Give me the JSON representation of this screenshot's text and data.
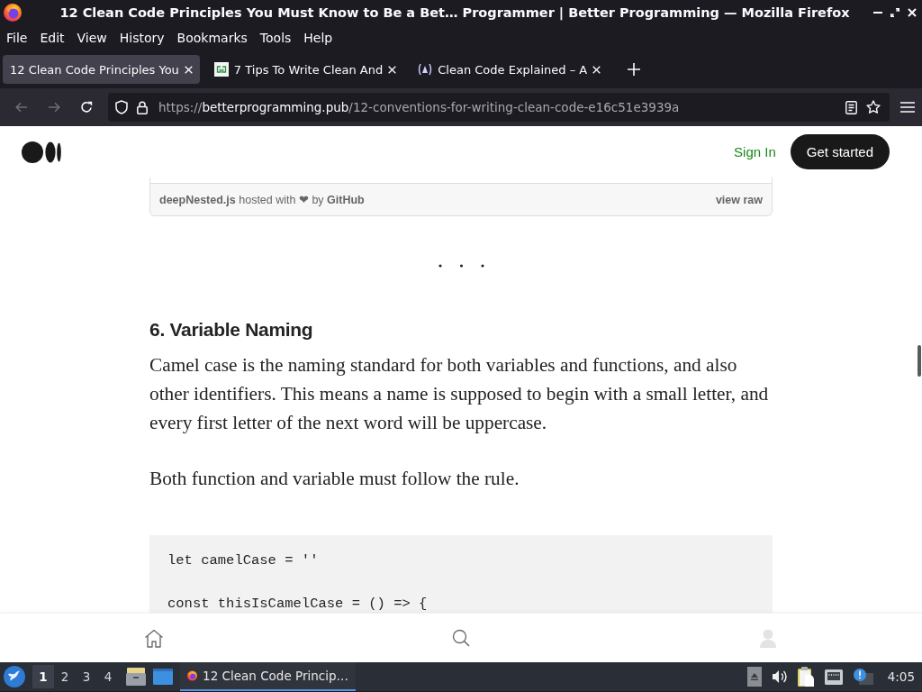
{
  "window": {
    "title": "12 Clean Code Principles You Must Know to Be a Bet… Programmer | Better Programming — Mozilla Firefox"
  },
  "menu": [
    "File",
    "Edit",
    "View",
    "History",
    "Bookmarks",
    "Tools",
    "Help"
  ],
  "tabs": [
    {
      "title": "12 Clean Code Principles You",
      "kind": "plain",
      "selected": true
    },
    {
      "title": "7 Tips To Write Clean And",
      "kind": "tile",
      "selected": false
    },
    {
      "title": "Clean Code Explained – A",
      "kind": "emblem",
      "selected": false
    }
  ],
  "navigation": {
    "buttons": [
      {
        "kind": "back",
        "disabled": true
      },
      {
        "kind": "forward",
        "disabled": true
      },
      {
        "kind": "reload",
        "disabled": false
      }
    ],
    "url": {
      "scheme": "https://",
      "host": "betterprogramming.pub",
      "path": "/12-conventions-for-writing-clean-code-e16c51e3939a"
    }
  },
  "page": {
    "header": {
      "sign_in": "Sign In",
      "get_started": "Get started"
    },
    "gist_footer": {
      "caption": "**deepNested.js** hosted with ❤ by **GitHub**",
      "view_raw": "view raw"
    },
    "article": {
      "heading": "6. Variable Naming",
      "paragraphs": [
        "Camel case is the naming standard for both variables and functions, and also other identifiers. This means a name is supposed to begin with a small letter, and every first letter of the next word will be uppercase.",
        "Both function and variable must follow the rule."
      ],
      "code": "let camelCase = ''\n\nconst thisIsCamelCase = () => {"
    }
  },
  "taskbar": {
    "workspaces": [
      {
        "label": "1",
        "selected": true
      },
      {
        "label": "2",
        "selected": false
      },
      {
        "label": "3",
        "selected": false
      },
      {
        "label": "4",
        "selected": false
      }
    ],
    "tasks": [
      {
        "title": "12 Clean Code Princip…",
        "selected": true
      }
    ],
    "clock": "4:05"
  }
}
